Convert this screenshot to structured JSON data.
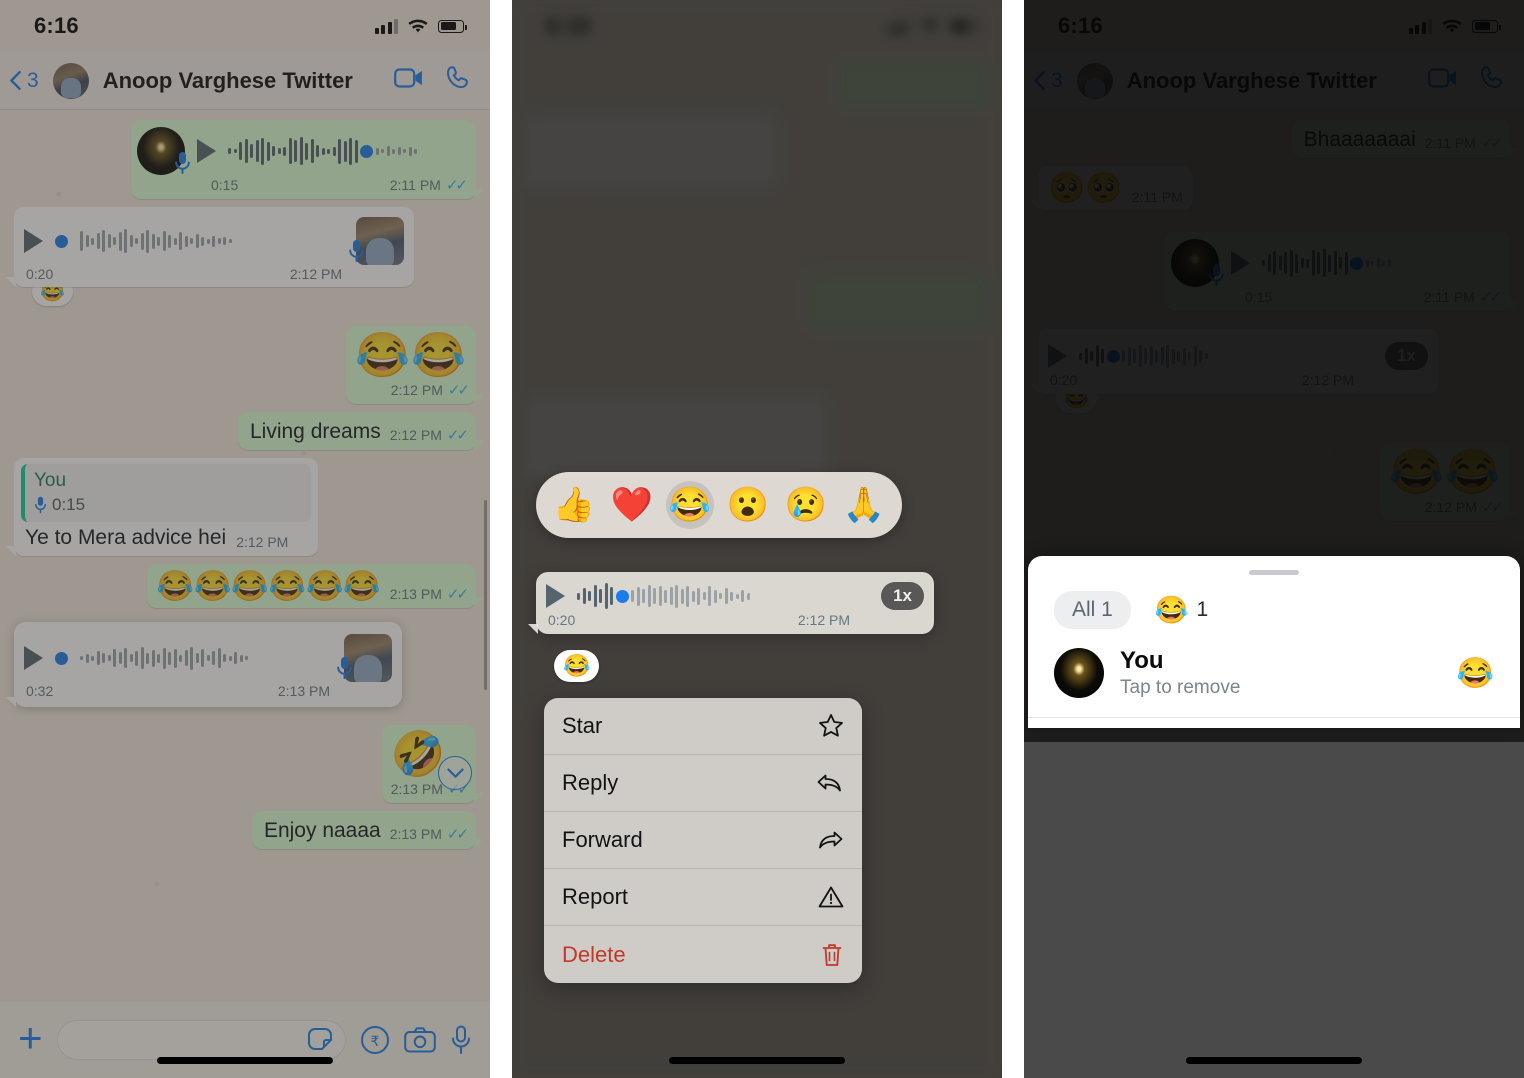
{
  "app": {
    "name": "WhatsApp",
    "platform": "iOS"
  },
  "status_bar": {
    "time": "6:16",
    "signal_icon": "cellular-bars-icon",
    "wifi_icon": "wifi-icon",
    "battery_icon": "battery-icon"
  },
  "chat_header": {
    "back_label": "3",
    "back_icon": "chevron-left-icon",
    "contact_name": "Anoop Varghese Twitter",
    "video_call_icon": "video-camera-icon",
    "voice_call_icon": "phone-icon"
  },
  "panel1": {
    "messages": [
      {
        "id": "m1",
        "type": "voice",
        "direction": "out",
        "duration": "0:15",
        "time": "2:11 PM",
        "ticks": "read",
        "avatar": "dark-avatar",
        "mic_icon": "microphone-icon"
      },
      {
        "id": "m2",
        "type": "voice",
        "direction": "in",
        "duration": "0:20",
        "time": "2:12 PM",
        "avatar": "contact-avatar",
        "mic_icon": "microphone-icon",
        "reaction": "😂"
      },
      {
        "id": "m3",
        "type": "emoji",
        "direction": "out",
        "text": "😂😂",
        "time": "2:12 PM",
        "ticks": "read"
      },
      {
        "id": "m4",
        "type": "text",
        "direction": "out",
        "text": "Living dreams",
        "time": "2:12 PM",
        "ticks": "read"
      },
      {
        "id": "m5",
        "type": "reply",
        "direction": "in",
        "quote_author": "You",
        "quote_duration": "0:15",
        "quote_icon": "microphone-icon",
        "text": "Ye to Mera advice hei",
        "time": "2:12 PM"
      },
      {
        "id": "m6",
        "type": "emoji",
        "direction": "out",
        "text": "😂😂😂😂😂😂",
        "time": "2:13 PM",
        "ticks": "read"
      },
      {
        "id": "m7",
        "type": "voice",
        "direction": "in",
        "highlighted": true,
        "duration": "0:32",
        "time": "2:13 PM",
        "avatar": "contact-avatar",
        "mic_icon": "microphone-icon"
      },
      {
        "id": "m8",
        "type": "emoji",
        "direction": "out",
        "text": "🤣",
        "time": "2:13 PM",
        "ticks": "read",
        "scroll_icon": "chevron-down-circle-icon"
      },
      {
        "id": "m9",
        "type": "text",
        "direction": "out",
        "text": "Enjoy naaaa",
        "time": "2:13 PM",
        "ticks": "read"
      }
    ],
    "input_bar": {
      "plus_icon": "plus-icon",
      "placeholder": "",
      "sticker_icon": "sticker-icon",
      "payment_icon": "rupee-payment-icon",
      "camera_icon": "camera-icon",
      "mic_icon": "microphone-icon"
    }
  },
  "panel2": {
    "reaction_bar": {
      "emojis": [
        "👍",
        "❤️",
        "😂",
        "😮",
        "😢",
        "🙏"
      ],
      "selected_index": 2
    },
    "focused_message": {
      "type": "voice",
      "duration": "0:20",
      "time": "2:12 PM",
      "speed_label": "1x",
      "play_icon": "play-icon",
      "applied_reaction": "😂"
    },
    "context_menu": [
      {
        "label": "Star",
        "icon": "star-icon",
        "danger": false
      },
      {
        "label": "Reply",
        "icon": "reply-arrow-icon",
        "danger": false
      },
      {
        "label": "Forward",
        "icon": "forward-arrow-icon",
        "danger": false
      },
      {
        "label": "Report",
        "icon": "warning-triangle-icon",
        "danger": false
      },
      {
        "label": "Delete",
        "icon": "trash-icon",
        "danger": true
      }
    ]
  },
  "panel3": {
    "background_messages": [
      {
        "type": "text",
        "direction": "out",
        "text": "Bhaaaaaaai",
        "time": "2:11 PM"
      },
      {
        "type": "emoji",
        "direction": "in",
        "text": "🥺🥺",
        "time": "2:11 PM"
      },
      {
        "type": "voice",
        "direction": "out",
        "duration": "0:15",
        "time": "2:11 PM"
      },
      {
        "type": "voice",
        "direction": "in",
        "duration": "0:20",
        "time": "2:12 PM",
        "speed_label": "1x",
        "reaction": "😂"
      },
      {
        "type": "emoji",
        "direction": "out",
        "text": "😂😂",
        "time": "2:12 PM"
      }
    ],
    "sheet": {
      "grabber_icon": "drag-handle-icon",
      "tab_all_label": "All 1",
      "tab_emoji": "😂",
      "tab_emoji_count": "1",
      "reactor": {
        "name": "You",
        "subtitle": "Tap to remove",
        "emoji": "😂",
        "avatar": "dark-avatar"
      }
    }
  },
  "colors": {
    "accent_blue": "#1b7ced",
    "outgoing_bubble": "#d9fdd3",
    "incoming_bubble": "#ffffff",
    "chat_background": "#efe7dd",
    "tick_blue": "#34b7f1",
    "delete_red": "#c0392b",
    "quote_green": "#06cf9c"
  }
}
